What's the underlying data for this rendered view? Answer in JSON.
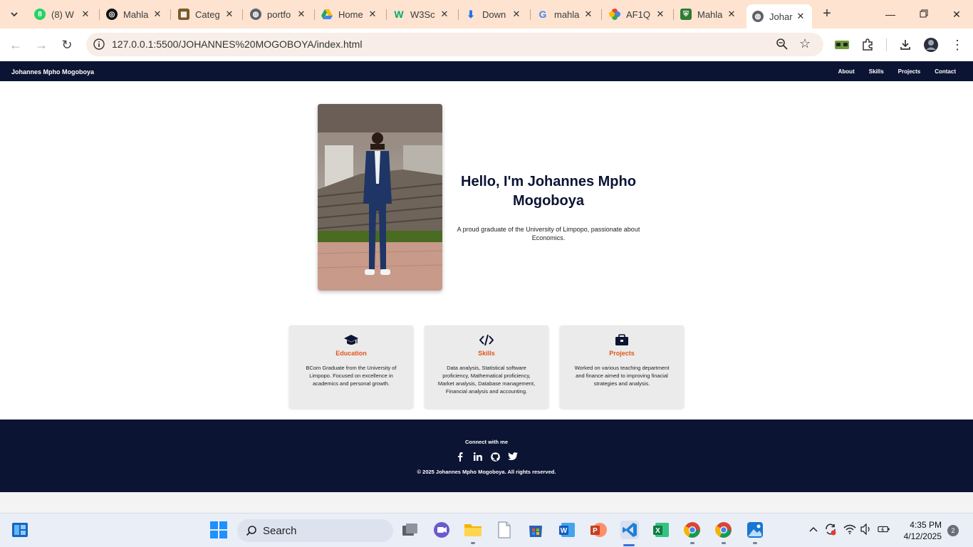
{
  "browser": {
    "tabs": [
      {
        "title": "(8) W",
        "favicon": "whatsapp-icon",
        "color": "#25d366"
      },
      {
        "title": "Mahla",
        "favicon": "openai-icon",
        "color": "#111111"
      },
      {
        "title": "Categ",
        "favicon": "category-icon",
        "color": "#7a5a2a"
      },
      {
        "title": "portfo",
        "favicon": "globe-icon",
        "color": "#5f6368"
      },
      {
        "title": "Home",
        "favicon": "google-drive-icon",
        "color": "#1fa463"
      },
      {
        "title": "W3Sc",
        "favicon": "w3schools-icon",
        "color": "#04aa6d"
      },
      {
        "title": "Down",
        "favicon": "download-icon",
        "color": "#1a73e8"
      },
      {
        "title": "mahla",
        "favicon": "google-icon",
        "color": "#4285f4"
      },
      {
        "title": "AF1Q",
        "favicon": "google-photos-icon",
        "color": "#fbbc04"
      },
      {
        "title": "Mahla",
        "favicon": "shield-app-icon",
        "color": "#2e7d32"
      },
      {
        "title": "Johar",
        "favicon": "globe-icon",
        "color": "#5f6368"
      }
    ],
    "url": "127.0.0.1:5500/JOHANNES%20MOGOBOYA/index.html"
  },
  "site": {
    "brand": "Johannes Mpho Mogoboya",
    "nav": [
      "About",
      "Skills",
      "Projects",
      "Contact"
    ],
    "hero": {
      "title": "Hello, I'm Johannes Mpho Mogoboya",
      "subtitle": "A proud graduate of the University of Limpopo, passionate about Economics."
    },
    "cards": [
      {
        "icon": "graduation-cap-icon",
        "title": "Education",
        "text": "BCom Graduate from the University of Limpopo. Focused on excellence in academics and personal growth."
      },
      {
        "icon": "code-icon",
        "title": "Skills",
        "text": "Data analysis, Statistical software proficiency, Mathematical proficiency, Market analysis, Database management, Financial analysis and accounting."
      },
      {
        "icon": "briefcase-icon",
        "title": "Projects",
        "text": "Worked on various teaching department and finance aimed to improving finacial strategies and analysis."
      }
    ],
    "footer": {
      "heading": "Connect with me",
      "social": [
        "facebook-icon",
        "linkedin-icon",
        "github-icon",
        "twitter-icon"
      ],
      "copyright": "© 2025 Johannes Mpho Mogoboya. All rights reserved."
    },
    "colors": {
      "navy": "#0b1433",
      "accent": "#e0561a"
    }
  },
  "taskbar": {
    "search_label": "Search",
    "time": "4:35 PM",
    "date": "4/12/2025",
    "notifications": "2"
  }
}
